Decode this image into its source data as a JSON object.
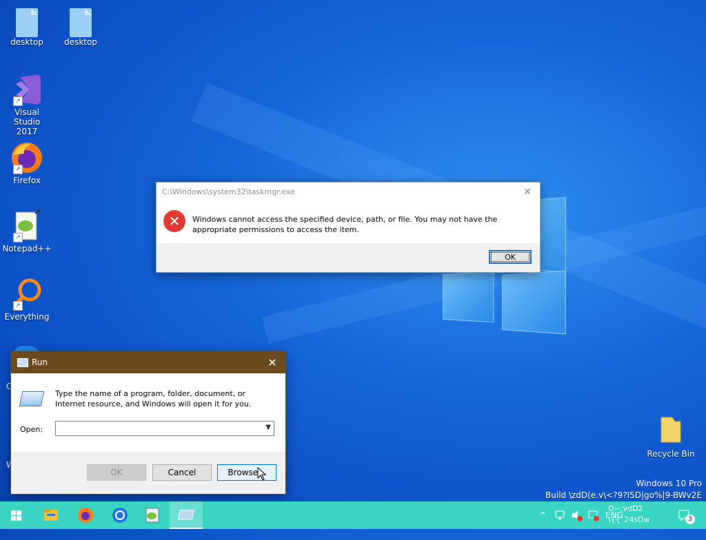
{
  "desktop": {
    "icons": [
      {
        "label": "desktop",
        "icon": "file-icon"
      },
      {
        "label": "desktop",
        "icon": "file-icon"
      },
      {
        "label": "Visual Studio 2017",
        "icon": "visual-studio-icon"
      },
      {
        "label": "Firefox",
        "icon": "firefox-icon"
      },
      {
        "label": "Notepad++",
        "icon": "notepadpp-icon"
      },
      {
        "label": "Everything",
        "icon": "everything-icon"
      },
      {
        "label": "Recycle Bin",
        "icon": "recycle-bin-icon"
      }
    ],
    "partial_labels": [
      "C",
      "W"
    ],
    "watermark": {
      "line1": "Windows 10 Pro",
      "line2": "Build \\zdD(e.v\\<?9?I5D|go%|9-BWv2E"
    }
  },
  "error_dialog": {
    "title": "C:\\Windows\\system32\\taskmgr.exe",
    "message": "Windows cannot access the specified device, path, or file. You may not have the appropriate permissions to access the item.",
    "ok_label": "OK",
    "icon": "error-icon"
  },
  "run_dialog": {
    "title": "Run",
    "description": "Type the name of a program, folder, document, or Internet resource, and Windows will open it for you.",
    "open_label": "Open:",
    "open_value": "",
    "ok_label": "OK",
    "cancel_label": "Cancel",
    "browse_label": "Browse..."
  },
  "taskbar": {
    "items": [
      "start-icon",
      "file-explorer-icon",
      "firefox-icon",
      "chrome-icon",
      "notepadpp-icon",
      "run-icon"
    ],
    "language": "ENG",
    "clock_line1": "O=;vdD2",
    "clock_line2": "\\{{`24sDw",
    "notification_count": "3",
    "accent_color": "#39d4c2"
  }
}
